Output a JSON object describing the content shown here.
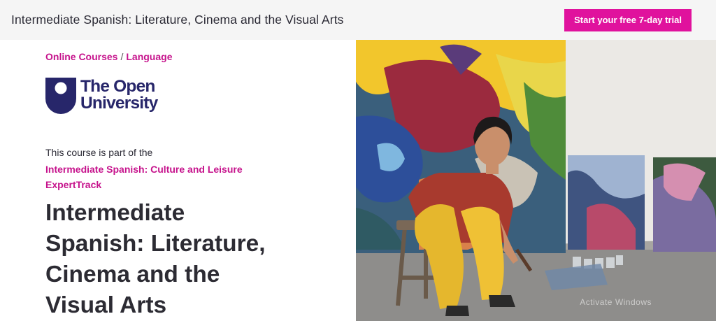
{
  "header": {
    "title": "Intermediate Spanish: Literature, Cinema and the Visual Arts",
    "cta_label": "Start your free 7-day trial"
  },
  "breadcrumb": {
    "items": [
      "Online Courses",
      "Language"
    ],
    "separator": "/"
  },
  "provider": {
    "name_line1": "The Open",
    "name_line2": "University"
  },
  "course": {
    "part_of_text": "This course is part of the",
    "expert_track_line1": "Intermediate Spanish: Culture and Leisure",
    "expert_track_line2": "ExpertTrack",
    "title_lines": [
      "Intermediate",
      "Spanish: Literature,",
      "Cinema and the",
      "Visual Arts"
    ]
  },
  "hero": {
    "watermark": "Activate Windows"
  },
  "colors": {
    "accent": "#e0129d",
    "link": "#c6138c",
    "brand_navy": "#27266a"
  }
}
